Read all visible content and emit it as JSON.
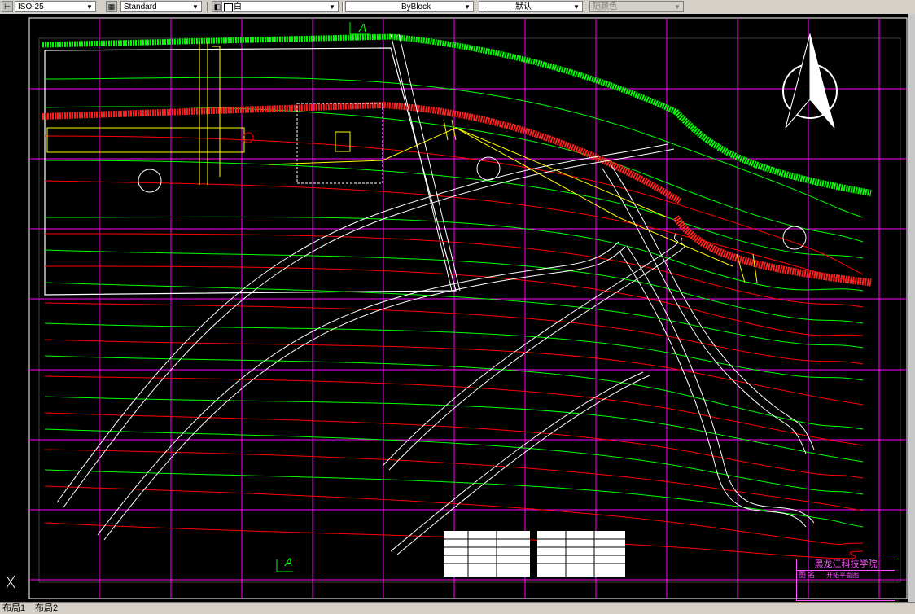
{
  "toolbar": {
    "dimstyle": "ISO-25",
    "tablestyle": "Standard",
    "color": "白",
    "linetype": "ByBlock",
    "lineweight": "默认",
    "plotstyle": "随颜色"
  },
  "drawing": {
    "section_marks": [
      "A",
      "A"
    ],
    "title_block": {
      "org": "黑龙江科技学院",
      "label": "图 名",
      "drawing_name": "开拓平面图"
    }
  },
  "tabs": [
    "布局1",
    "布局2"
  ],
  "colors": {
    "grid": "#ff00ff",
    "green_contour": "#00ff00",
    "red_contour": "#ff0000",
    "yellow": "#ffff00",
    "white": "#ffffff",
    "toolbar_bg": "#d4d0c8"
  }
}
